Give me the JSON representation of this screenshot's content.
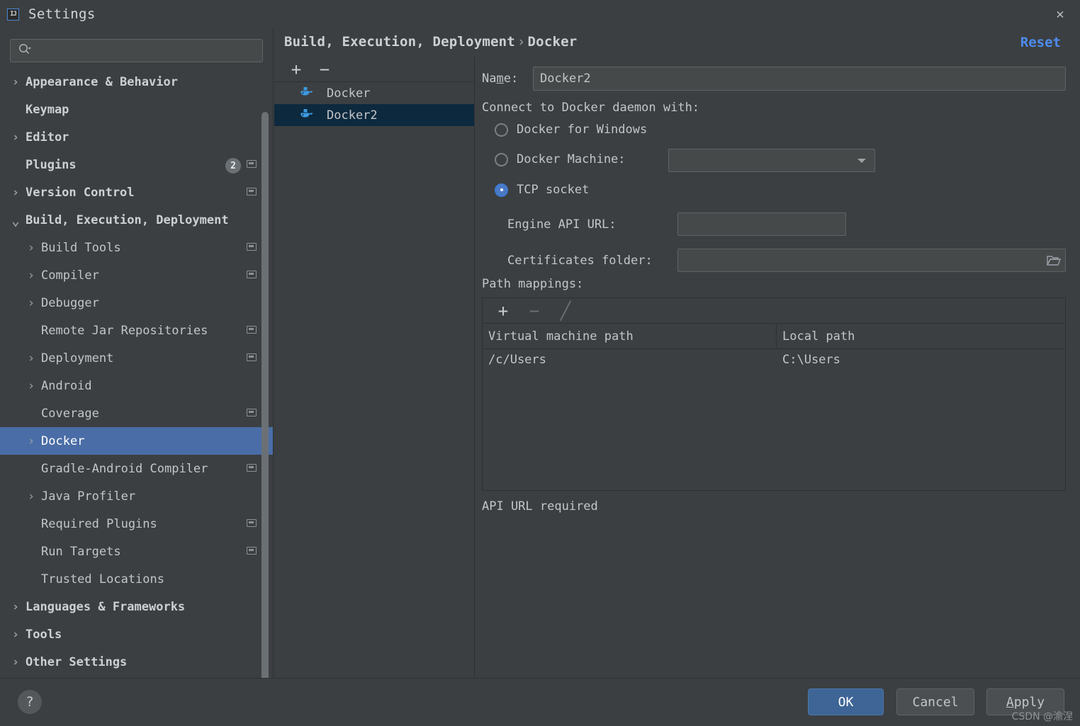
{
  "window": {
    "title": "Settings",
    "app_icon": "IJ",
    "close_icon": "✕"
  },
  "search": {
    "value": "",
    "placeholder": "",
    "icon": "search-icon"
  },
  "sidebar": {
    "items": [
      {
        "label": "Appearance & Behavior",
        "arrow": "›",
        "indent": 0,
        "bold": true,
        "badge": null,
        "proj": false,
        "selected": false
      },
      {
        "label": "Keymap",
        "arrow": "",
        "indent": 0,
        "bold": true,
        "badge": null,
        "proj": false,
        "selected": false
      },
      {
        "label": "Editor",
        "arrow": "›",
        "indent": 0,
        "bold": true,
        "badge": null,
        "proj": false,
        "selected": false
      },
      {
        "label": "Plugins",
        "arrow": "",
        "indent": 0,
        "bold": true,
        "badge": "2",
        "proj": true,
        "selected": false
      },
      {
        "label": "Version Control",
        "arrow": "›",
        "indent": 0,
        "bold": true,
        "badge": null,
        "proj": true,
        "selected": false
      },
      {
        "label": "Build, Execution, Deployment",
        "arrow": "⌄",
        "indent": 0,
        "bold": true,
        "badge": null,
        "proj": false,
        "selected": false
      },
      {
        "label": "Build Tools",
        "arrow": "›",
        "indent": 1,
        "bold": false,
        "badge": null,
        "proj": true,
        "selected": false
      },
      {
        "label": "Compiler",
        "arrow": "›",
        "indent": 1,
        "bold": false,
        "badge": null,
        "proj": true,
        "selected": false
      },
      {
        "label": "Debugger",
        "arrow": "›",
        "indent": 1,
        "bold": false,
        "badge": null,
        "proj": false,
        "selected": false
      },
      {
        "label": "Remote Jar Repositories",
        "arrow": "",
        "indent": 1,
        "bold": false,
        "badge": null,
        "proj": true,
        "selected": false
      },
      {
        "label": "Deployment",
        "arrow": "›",
        "indent": 1,
        "bold": false,
        "badge": null,
        "proj": true,
        "selected": false
      },
      {
        "label": "Android",
        "arrow": "›",
        "indent": 1,
        "bold": false,
        "badge": null,
        "proj": false,
        "selected": false
      },
      {
        "label": "Coverage",
        "arrow": "",
        "indent": 1,
        "bold": false,
        "badge": null,
        "proj": true,
        "selected": false
      },
      {
        "label": "Docker",
        "arrow": "›",
        "indent": 1,
        "bold": false,
        "badge": null,
        "proj": false,
        "selected": true
      },
      {
        "label": "Gradle-Android Compiler",
        "arrow": "",
        "indent": 1,
        "bold": false,
        "badge": null,
        "proj": true,
        "selected": false
      },
      {
        "label": "Java Profiler",
        "arrow": "›",
        "indent": 1,
        "bold": false,
        "badge": null,
        "proj": false,
        "selected": false
      },
      {
        "label": "Required Plugins",
        "arrow": "",
        "indent": 1,
        "bold": false,
        "badge": null,
        "proj": true,
        "selected": false
      },
      {
        "label": "Run Targets",
        "arrow": "",
        "indent": 1,
        "bold": false,
        "badge": null,
        "proj": true,
        "selected": false
      },
      {
        "label": "Trusted Locations",
        "arrow": "",
        "indent": 1,
        "bold": false,
        "badge": null,
        "proj": false,
        "selected": false
      },
      {
        "label": "Languages & Frameworks",
        "arrow": "›",
        "indent": 0,
        "bold": true,
        "badge": null,
        "proj": false,
        "selected": false
      },
      {
        "label": "Tools",
        "arrow": "›",
        "indent": 0,
        "bold": true,
        "badge": null,
        "proj": false,
        "selected": false
      },
      {
        "label": "Other Settings",
        "arrow": "›",
        "indent": 0,
        "bold": true,
        "badge": null,
        "proj": false,
        "selected": false
      }
    ]
  },
  "header": {
    "breadcrumb_root": "Build, Execution, Deployment",
    "breadcrumb_sep": "›",
    "breadcrumb_leaf": "Docker",
    "reset_label": "Reset"
  },
  "docker_list": {
    "add_label": "+",
    "remove_label": "−",
    "items": [
      {
        "label": "Docker",
        "selected": false
      },
      {
        "label": "Docker2",
        "selected": true
      }
    ]
  },
  "form": {
    "name_label_pre": "Na",
    "name_label_mn": "m",
    "name_label_post": "e:",
    "name_value": "Docker2",
    "connect_label": "Connect to Docker daemon with:",
    "radios": [
      {
        "label": "Docker for Windows",
        "checked": false
      },
      {
        "label": "Docker Machine:",
        "checked": false
      },
      {
        "label": "TCP socket",
        "checked": true
      }
    ],
    "machine_select_value": "",
    "api_url_label": "Engine API URL:",
    "api_url_value": "",
    "cert_label": "Certificates folder:",
    "cert_value": "",
    "folder_icon": "folder-icon",
    "path_mappings_label": "Path mappings:",
    "pm_toolbar": {
      "add": "+",
      "remove": "−",
      "edit": "╱"
    },
    "pm_columns": [
      "Virtual machine path",
      "Local path"
    ],
    "pm_rows": [
      {
        "vm": "/c/Users",
        "local": "C:\\Users"
      }
    ],
    "error_message": "API URL required"
  },
  "footer": {
    "help_label": "?",
    "ok_label": "OK",
    "cancel_label": "Cancel",
    "apply_label_mn": "A",
    "apply_label_rest": "pply",
    "watermark": "CSDN @渝涅"
  },
  "colors": {
    "accent_selection": "#4a6da7",
    "list_selection": "#0d293e",
    "link": "#4d8cf0",
    "ok_button": "#3e6596",
    "background": "#3c3f41",
    "field_background": "#45494a",
    "docker_blue": "#3d9ae0"
  }
}
